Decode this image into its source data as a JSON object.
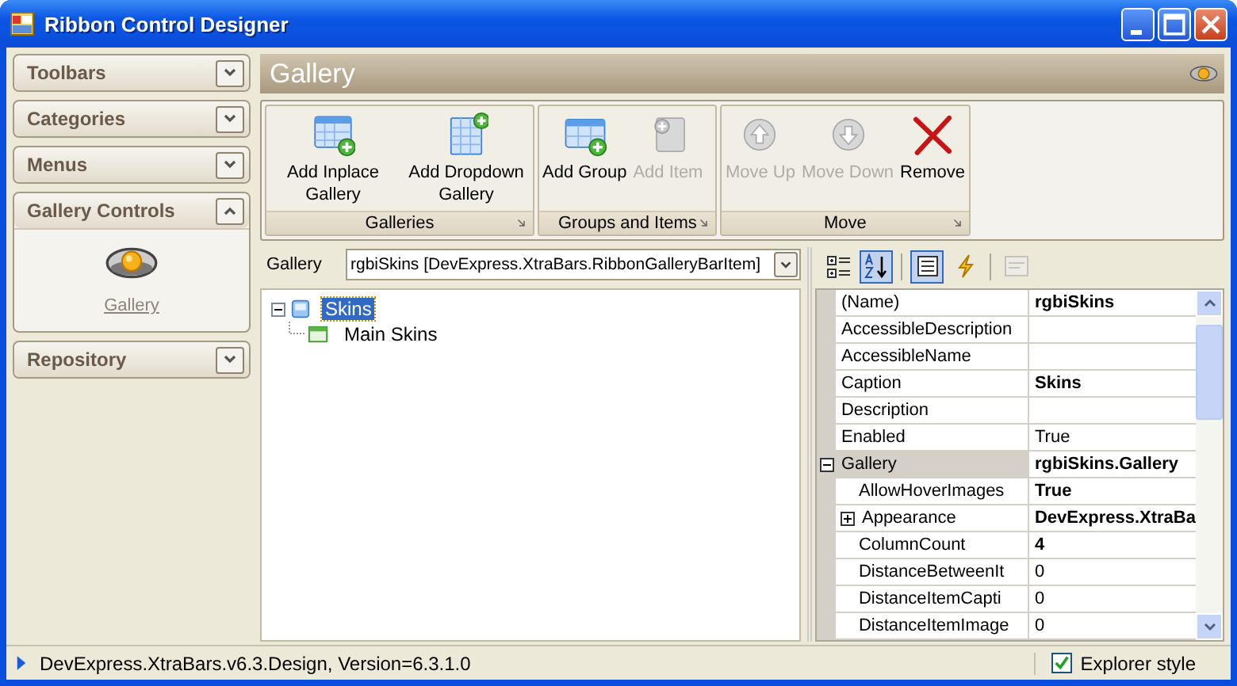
{
  "window": {
    "title": "Ribbon Control Designer"
  },
  "nav_groups": [
    {
      "label": "Toolbars",
      "expanded": false
    },
    {
      "label": "Categories",
      "expanded": false
    },
    {
      "label": "Menus",
      "expanded": false
    },
    {
      "label": "Gallery Controls",
      "expanded": true,
      "items": [
        {
          "label": "Gallery"
        }
      ]
    },
    {
      "label": "Repository",
      "expanded": false
    }
  ],
  "header": {
    "title": "Gallery"
  },
  "ribbon_groups": [
    {
      "caption": "Galleries",
      "items": [
        {
          "label": "Add Inplace Gallery",
          "kind": "inplace",
          "disabled": false
        },
        {
          "label": "Add Dropdown Gallery",
          "kind": "dropdown",
          "disabled": false
        }
      ]
    },
    {
      "caption": "Groups and Items",
      "items": [
        {
          "label": "Add Group",
          "kind": "group",
          "disabled": false
        },
        {
          "label": "Add Item",
          "kind": "item",
          "disabled": true
        }
      ]
    },
    {
      "caption": "Move",
      "items": [
        {
          "label": "Move Up",
          "kind": "up",
          "disabled": true
        },
        {
          "label": "Move Down",
          "kind": "down",
          "disabled": true
        },
        {
          "label": "Remove",
          "kind": "remove",
          "disabled": false
        }
      ]
    }
  ],
  "gallery_selector": {
    "label": "Gallery",
    "value": "rgbiSkins [DevExpress.XtraBars.RibbonGalleryBarItem]"
  },
  "tree": [
    {
      "label": "Skins",
      "selected": true,
      "expanded": true,
      "children": [
        {
          "label": "Main Skins",
          "selected": false
        }
      ]
    }
  ],
  "property_toolbar": [
    {
      "kind": "categorized",
      "selected": false,
      "disabled": false
    },
    {
      "kind": "alphabetical",
      "selected": true,
      "disabled": false
    },
    {
      "kind": "properties",
      "selected": true,
      "disabled": false
    },
    {
      "kind": "events",
      "selected": false,
      "disabled": false
    },
    {
      "kind": "pages",
      "selected": false,
      "disabled": true
    }
  ],
  "properties": [
    {
      "name": "(Name)",
      "value": "rgbiSkins",
      "bold": true
    },
    {
      "name": "AccessibleDescription"
    },
    {
      "name": "AccessibleName"
    },
    {
      "name": "Caption",
      "value": "Skins",
      "bold": true
    },
    {
      "name": "Description"
    },
    {
      "name": "Enabled",
      "value": "True",
      "bold": false
    },
    {
      "name": "Gallery",
      "value": "rgbiSkins.Gallery",
      "bold": true,
      "expanded": true,
      "children": [
        {
          "name": "AllowHoverImages",
          "value": "True",
          "bold": true
        },
        {
          "name": "Appearance",
          "value": "DevExpress.XtraBa",
          "bold": true,
          "expanded": false
        },
        {
          "name": "ColumnCount",
          "value": "4",
          "bold": true
        },
        {
          "name": "DistanceBetweenIt",
          "value": "0",
          "bold": false
        },
        {
          "name": "DistanceItemCapti",
          "value": "0",
          "bold": false
        },
        {
          "name": "DistanceItemImage",
          "value": "0",
          "bold": false
        }
      ]
    }
  ],
  "status_bar": {
    "text": "DevExpress.XtraBars.v6.3.Design, Version=6.3.1.0",
    "explorer_style": {
      "label": "Explorer style",
      "checked": true
    }
  }
}
